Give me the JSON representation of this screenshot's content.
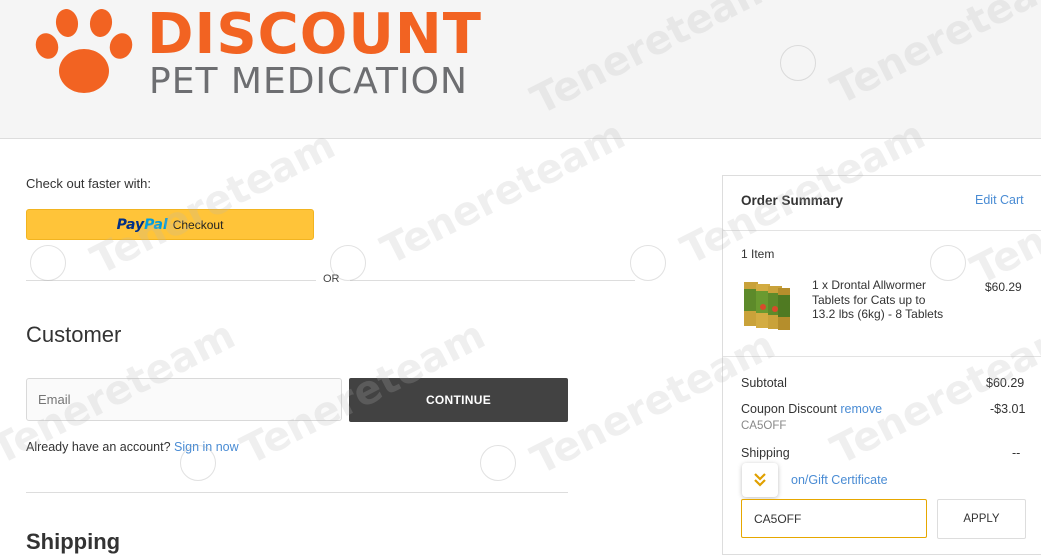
{
  "brand": {
    "name_top": "DISCOUNT",
    "name_bottom": "PET MEDICATION",
    "logo_icon": "paw-print-icon",
    "orange": "#f26322",
    "gray": "#6d6e71"
  },
  "checkout": {
    "faster_label": "Check out faster with:",
    "paypal_word1": "Pay",
    "paypal_word2": "Pal",
    "paypal_action": "Checkout",
    "or_label": "OR"
  },
  "customer": {
    "heading": "Customer",
    "email_placeholder": "Email",
    "continue_label": "CONTINUE",
    "account_prompt": "Already have an account?",
    "sign_in_label": "Sign in now"
  },
  "shipping": {
    "heading": "Shipping"
  },
  "order_summary": {
    "title": "Order Summary",
    "edit_cart_label": "Edit Cart",
    "item_count": "1 Item",
    "items": [
      {
        "name": "1 x Drontal Allwormer Tablets for Cats up to 13.2 lbs (6kg) - 8 Tablets",
        "price": "$60.29"
      }
    ],
    "subtotal_label": "Subtotal",
    "subtotal_value": "$60.29",
    "coupon_label": "Coupon Discount",
    "coupon_remove_label": "remove",
    "coupon_value": "-$3.01",
    "coupon_code": "CA5OFF",
    "shipping_label": "Shipping",
    "shipping_value": "--",
    "gift_cert_label": "on/Gift Certificate",
    "coupon_input_value": "CA5OFF",
    "apply_label": "APPLY"
  },
  "watermark_text": "Tenereteam",
  "colors": {
    "accent_link": "#4a8cd4",
    "paypal_yellow": "#ffc439",
    "continue_bg": "#424242",
    "coupon_border": "#e6a700"
  }
}
